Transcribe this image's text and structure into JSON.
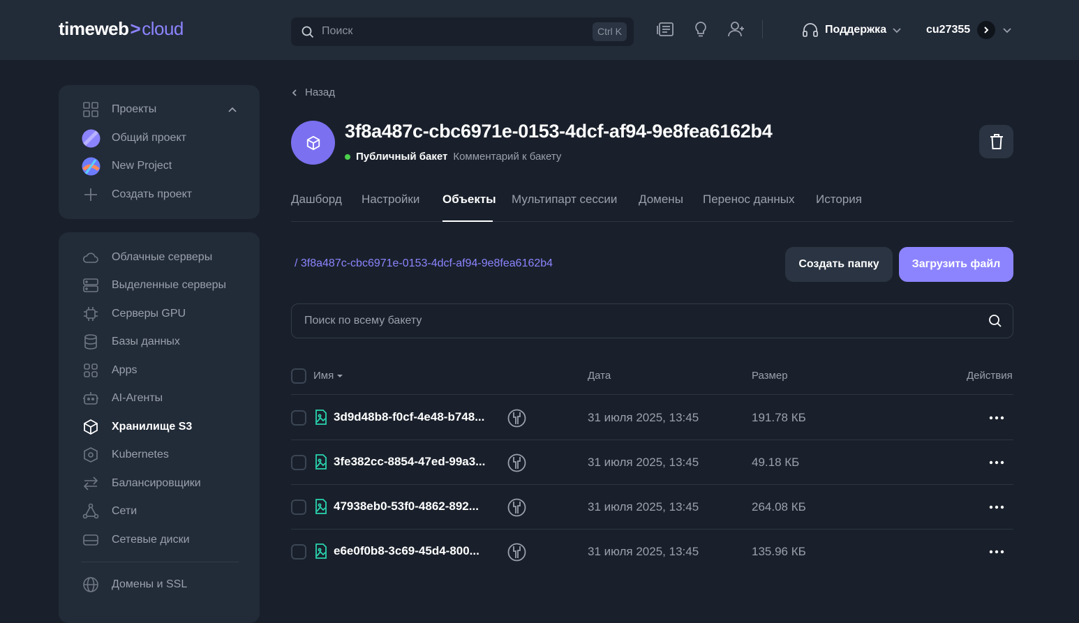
{
  "header": {
    "logo_main": "timeweb",
    "logo_sep": ">",
    "logo_cloud": "cloud",
    "search_placeholder": "Поиск",
    "search_shortcut": "Ctrl K",
    "support_label": "Поддержка",
    "username": "cu27355"
  },
  "projects": {
    "title": "Проекты",
    "items": [
      {
        "label": "Общий проект"
      },
      {
        "label": "New Project"
      },
      {
        "label": "Создать проект"
      }
    ]
  },
  "nav": {
    "items": [
      {
        "label": "Облачные серверы"
      },
      {
        "label": "Выделенные серверы"
      },
      {
        "label": "Серверы GPU"
      },
      {
        "label": "Базы данных"
      },
      {
        "label": "Apps"
      },
      {
        "label": "AI-Агенты"
      },
      {
        "label": "Хранилище S3"
      },
      {
        "label": "Kubernetes"
      },
      {
        "label": "Балансировщики"
      },
      {
        "label": "Сети"
      },
      {
        "label": "Сетевые диски"
      },
      {
        "label": "Домены и SSL"
      }
    ],
    "active": "Хранилище S3"
  },
  "bucket": {
    "back_label": "Назад",
    "name": "3f8a487c-cbc6971e-0153-4dcf-af94-9e8fea6162b4",
    "type": "Публичный бакет",
    "comment": "Комментарий к бакету",
    "status_color": "#4cd04c"
  },
  "tabs": [
    {
      "label": "Дашборд"
    },
    {
      "label": "Настройки"
    },
    {
      "label": "Объекты"
    },
    {
      "label": "Мультипарт сессии"
    },
    {
      "label": "Домены"
    },
    {
      "label": "Перенос данных"
    },
    {
      "label": "История"
    }
  ],
  "active_tab": "Объекты",
  "objects": {
    "path": "/ 3f8a487c-cbc6971e-0153-4dcf-af94-9e8fea6162b4",
    "create_folder_label": "Создать папку",
    "upload_label": "Загрузить файл",
    "search_placeholder": "Поиск по всему бакету",
    "columns": {
      "name": "Имя",
      "date": "Дата",
      "size": "Размер",
      "actions": "Действия"
    },
    "rows": [
      {
        "name": "3d9d48b8-f0cf-4e48-b748...",
        "date": "31 июля 2025, 13:45",
        "size": "191.78 КБ"
      },
      {
        "name": "3fe382cc-8854-47ed-99a3...",
        "date": "31 июля 2025, 13:45",
        "size": "49.18 КБ"
      },
      {
        "name": "47938eb0-53f0-4862-892...",
        "date": "31 июля 2025, 13:45",
        "size": "264.08 КБ"
      },
      {
        "name": "e6e0f0b8-3c69-45d4-800...",
        "date": "31 июля 2025, 13:45",
        "size": "135.96 КБ"
      }
    ]
  },
  "colors": {
    "accent": "#8c84ff",
    "file_icon": "#2ad4b0"
  }
}
